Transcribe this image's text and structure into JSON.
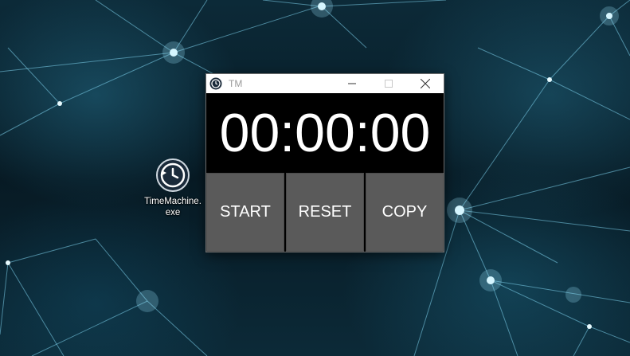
{
  "desktop": {
    "icons": [
      {
        "label": "TimeMachine.exe",
        "icon": "history-clock-icon"
      }
    ]
  },
  "window": {
    "title": "TM",
    "title_icon": "app-clock-icon",
    "controls": [
      "minimize-icon",
      "maximize-icon",
      "close-icon"
    ],
    "timer_display": "00:00:00",
    "buttons": {
      "start_label": "START",
      "reset_label": "RESET",
      "copy_label": "COPY"
    }
  },
  "colors": {
    "button_bg": "#5a5a5a",
    "display_bg": "#000000",
    "display_text": "#ffffff",
    "titlebar_bg": "#ffffff"
  }
}
